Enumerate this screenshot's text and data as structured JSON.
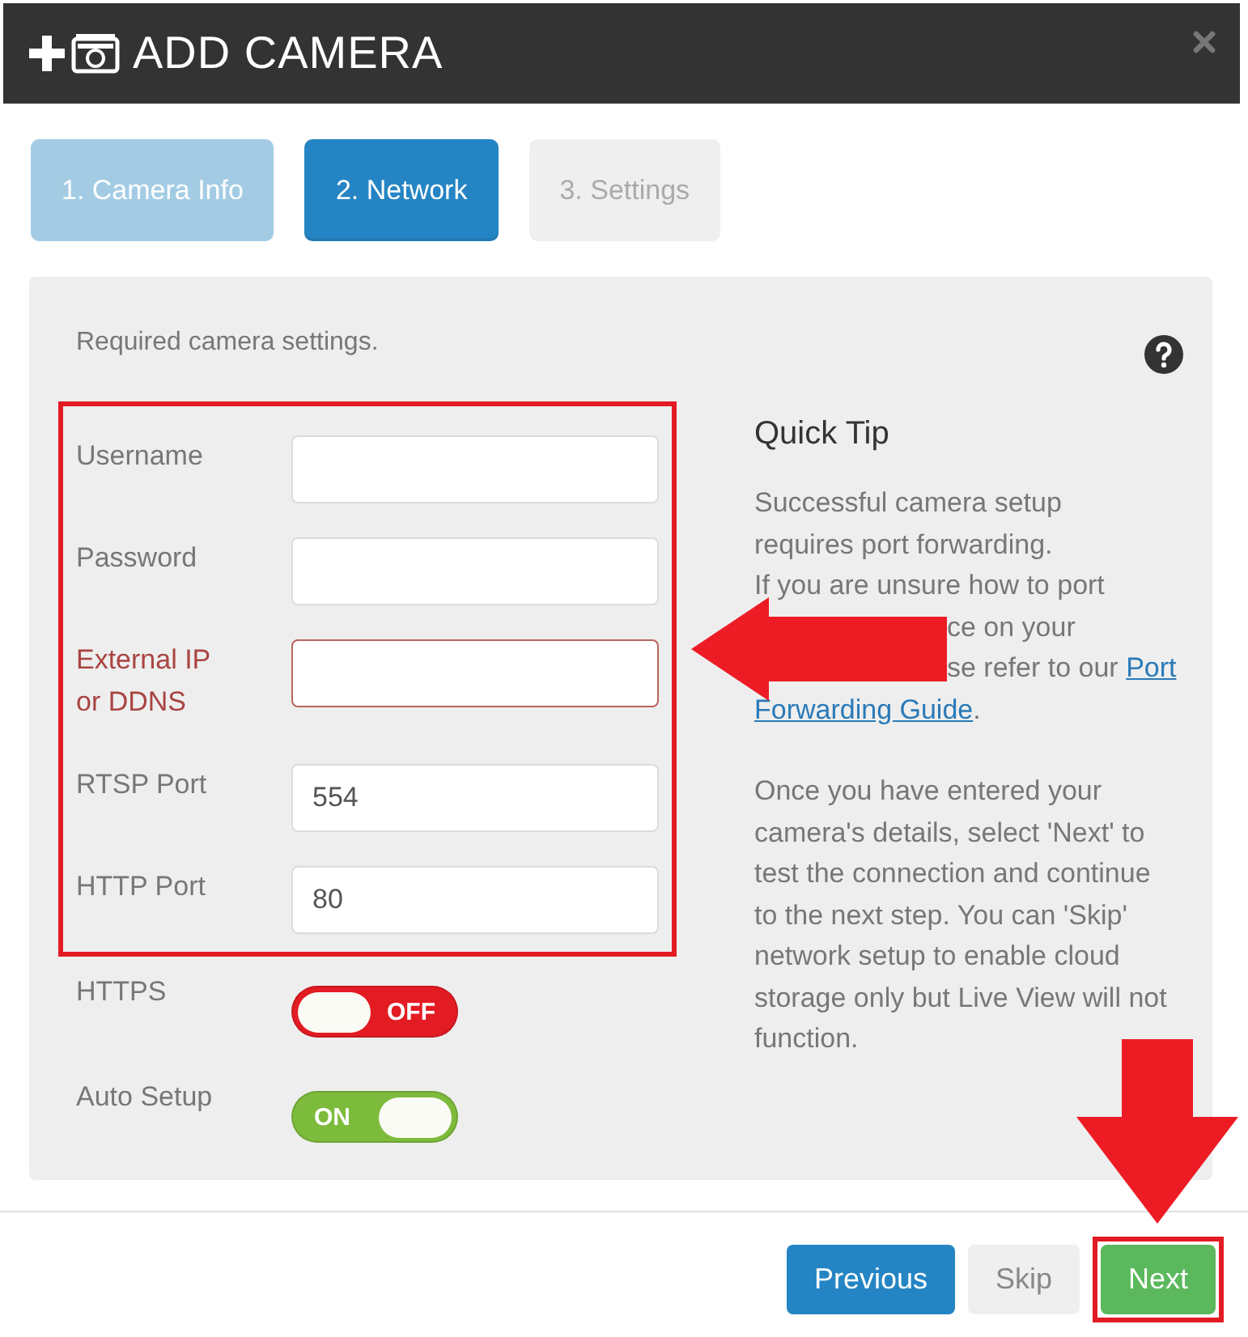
{
  "dialog": {
    "title": "ADD CAMERA"
  },
  "tabs": [
    {
      "label": "1. Camera Info",
      "kind": "done",
      "selected": false
    },
    {
      "label": "2. Network",
      "kind": "current",
      "selected": true
    },
    {
      "label": "3. Settings",
      "kind": "upcoming",
      "selected": false
    }
  ],
  "form": {
    "intro": "Required camera settings.",
    "fields": [
      {
        "label": "Username",
        "error": false
      },
      {
        "label": "Password",
        "error": false
      },
      {
        "label": "External IP or DDNS",
        "error": true
      },
      {
        "label": "RTSP Port",
        "value": "554",
        "error": false
      },
      {
        "label": "HTTP Port",
        "value": "80",
        "error": false
      }
    ],
    "toggles": [
      {
        "label": "HTTPS",
        "on": false,
        "text": "OFF"
      },
      {
        "label": "Auto Setup",
        "on": true,
        "text": "ON"
      }
    ]
  },
  "tip": {
    "title": "Quick Tip",
    "intro": "Successful camera setup requires port forwarding.",
    "unsure": "If you are unsure how to port",
    "covered_lines": [
      {
        "segments": [
          {
            "kind": "text",
            "text": "ce on your"
          }
        ]
      },
      {
        "segments": [
          {
            "kind": "text",
            "text": "se refer to our "
          },
          {
            "kind": "link",
            "text": "Port"
          }
        ]
      }
    ],
    "after_lines": [
      {
        "segments": [
          {
            "kind": "link",
            "text": "Forwarding Guide"
          },
          {
            "kind": "text",
            "text": "."
          }
        ]
      }
    ],
    "body": "Once you have entered your camera's details, select 'Next' to test the connection and continue to the next step. You can 'Skip' network setup to enable cloud storage only but Live View will not function."
  },
  "buttons": [
    {
      "label": "Previous",
      "kind": "primary"
    },
    {
      "label": "Skip",
      "kind": "default"
    },
    {
      "label": "Next",
      "kind": "success",
      "highlighted": true
    }
  ]
}
